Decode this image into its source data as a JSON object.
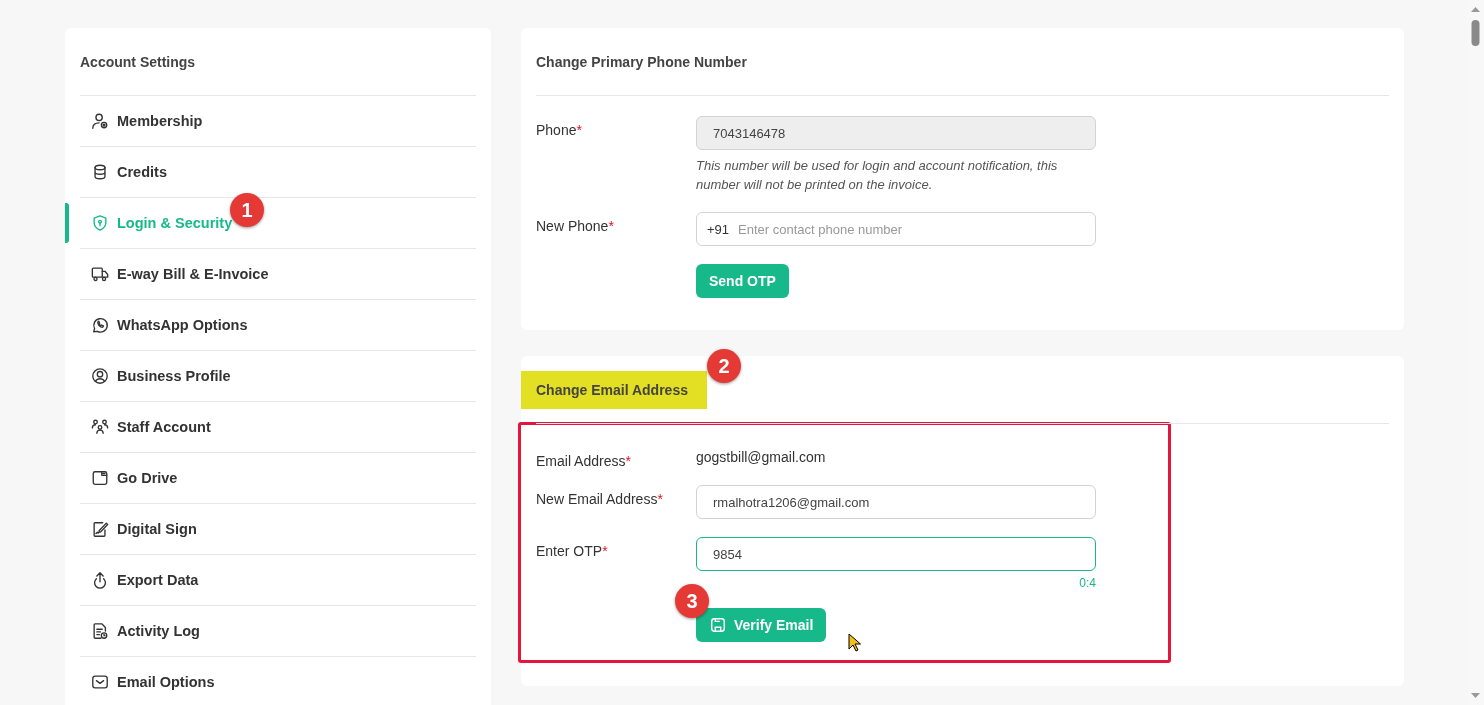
{
  "sidebar": {
    "title": "Account Settings",
    "items": [
      {
        "label": "Membership",
        "selected": false
      },
      {
        "label": "Credits",
        "selected": false
      },
      {
        "label": "Login & Security",
        "selected": true,
        "badge": "1"
      },
      {
        "label": "E-way Bill & E-Invoice",
        "selected": false
      },
      {
        "label": "WhatsApp Options",
        "selected": false
      },
      {
        "label": "Business Profile",
        "selected": false
      },
      {
        "label": "Staff Account",
        "selected": false
      },
      {
        "label": "Go Drive",
        "selected": false
      },
      {
        "label": "Digital Sign",
        "selected": false
      },
      {
        "label": "Export Data",
        "selected": false
      },
      {
        "label": "Activity Log",
        "selected": false
      },
      {
        "label": "Email Options",
        "selected": false
      }
    ]
  },
  "phone_card": {
    "title": "Change Primary Phone Number",
    "phone": {
      "label": "Phone",
      "required_mark": "*",
      "value": "7043146478",
      "disabled": true,
      "help": "This number will be used for login and account notification, this number will not be printed on the invoice."
    },
    "new_phone": {
      "label": "New Phone",
      "required_mark": "*",
      "prefix": "+91",
      "placeholder": "Enter contact phone number"
    },
    "button": "Send OTP"
  },
  "email_card": {
    "title": "Change Email Address",
    "title_highlighted": true,
    "title_badge": "2",
    "form_outlined": true,
    "email": {
      "label": "Email Address",
      "required_mark": "*",
      "value": "gogstbill@gmail.com"
    },
    "new_email": {
      "label": "New Email Address",
      "required_mark": "*",
      "value": "rmalhotra1206@gmail.com"
    },
    "otp": {
      "label": "Enter OTP",
      "required_mark": "*",
      "value": "9854",
      "focused": true,
      "timer": "0:4"
    },
    "button": "Verify Email",
    "button_badge": "3"
  }
}
